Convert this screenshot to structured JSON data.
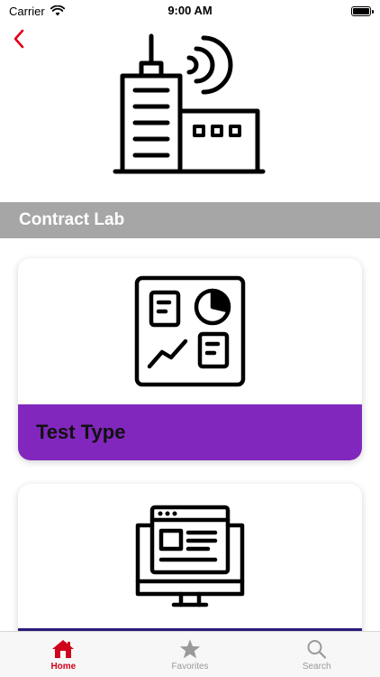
{
  "status_bar": {
    "carrier": "Carrier",
    "time": "9:00 AM"
  },
  "header": {
    "back_icon": "chevron-left-icon",
    "hero_icon": "building-antenna-icon",
    "accent_color": "#e0001b"
  },
  "section": {
    "title": "Contract Lab",
    "background": "#a6a6a6"
  },
  "cards": [
    {
      "icon": "dashboard-board-icon",
      "label": "Test Type",
      "footer_color": "#8127bd"
    },
    {
      "icon": "computer-monitor-icon",
      "label": ""
    }
  ],
  "tab_bar": {
    "active_color": "#d0021b",
    "tabs": [
      {
        "label": "Home",
        "icon": "home-icon",
        "active": true
      },
      {
        "label": "Favorites",
        "icon": "star-icon",
        "active": false
      },
      {
        "label": "Search",
        "icon": "search-icon",
        "active": false
      }
    ]
  }
}
